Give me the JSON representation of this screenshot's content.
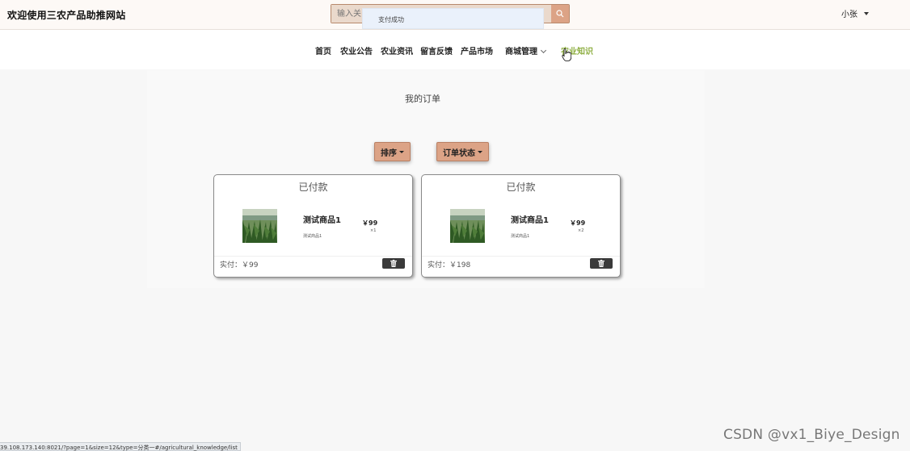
{
  "header": {
    "site_title": "欢迎使用三农产品助推网站",
    "search_placeholder": "输入关",
    "toast": "支付成功",
    "username": "小张"
  },
  "nav": {
    "items": [
      {
        "label": "首页"
      },
      {
        "label": "农业公告"
      },
      {
        "label": "农业资讯"
      },
      {
        "label": "留言反馈"
      },
      {
        "label": "产品市场"
      },
      {
        "label": "商城管理"
      },
      {
        "label": "农业知识"
      }
    ],
    "active": "农业知识"
  },
  "main": {
    "title": "我的订单",
    "sort_label": "排序",
    "status_filter_label": "订单状态",
    "orders": [
      {
        "status": "已付款",
        "name": "测试商品1",
        "subtitle": "测试商品1",
        "price": "￥99",
        "qty": "×1",
        "paid": "实付：￥99"
      },
      {
        "status": "已付款",
        "name": "测试商品1",
        "subtitle": "测试商品1",
        "price": "￥99",
        "qty": "×2",
        "paid": "实付：￥198"
      }
    ]
  },
  "status_url": "39.108.173.140:8021/?page=1&size=12&type=分类一#/agricultural_knowledge/list",
  "watermark": "CSDN @vx1_Biye_Design",
  "colors": {
    "accent": "#dca386",
    "active_nav": "#8cad3e",
    "header_bg": "#fdf9f6",
    "page_bg": "#f7f7f7"
  },
  "icons": [
    "search-icon",
    "trash-icon",
    "hand-pointer-icon",
    "chevron-down-icon"
  ]
}
